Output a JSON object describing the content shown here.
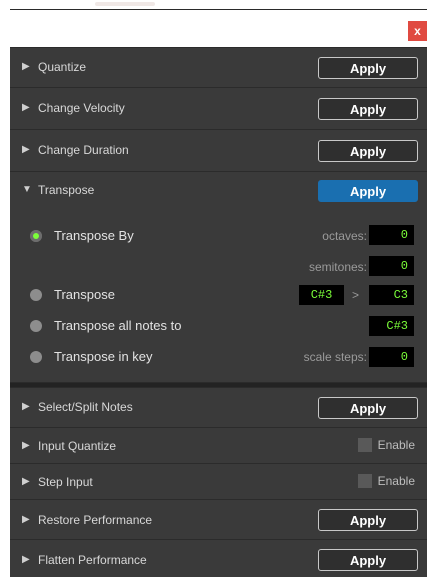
{
  "window": {
    "close_label": "x"
  },
  "sections": {
    "quantize": {
      "title": "Quantize",
      "arrow": "▶",
      "apply": "Apply"
    },
    "change_velocity": {
      "title": "Change Velocity",
      "arrow": "▶",
      "apply": "Apply"
    },
    "change_duration": {
      "title": "Change Duration",
      "arrow": "▶",
      "apply": "Apply"
    },
    "transpose": {
      "title": "Transpose",
      "arrow": "▼",
      "apply": "Apply",
      "options": {
        "transpose_by": {
          "label": "Transpose By",
          "selected": true
        },
        "transpose": {
          "label": "Transpose",
          "selected": false
        },
        "transpose_all": {
          "label": "Transpose all notes to",
          "selected": false
        },
        "transpose_in_key": {
          "label": "Transpose in key",
          "selected": false
        }
      },
      "fields": {
        "octaves_label": "octaves:",
        "octaves_value": "0",
        "semitones_label": "semitones:",
        "semitones_value": "0",
        "from_note": "C#3",
        "arrow_symbol": ">",
        "to_note": "C3",
        "all_notes_to": "C#3",
        "scale_steps_label": "scale steps:",
        "scale_steps_value": "0"
      }
    },
    "select_split": {
      "title": "Select/Split Notes",
      "arrow": "▶",
      "apply": "Apply"
    },
    "input_quantize": {
      "title": "Input Quantize",
      "arrow": "▶",
      "enable": "Enable"
    },
    "step_input": {
      "title": "Step Input",
      "arrow": "▶",
      "enable": "Enable"
    },
    "restore_performance": {
      "title": "Restore Performance",
      "arrow": "▶",
      "apply": "Apply"
    },
    "flatten_performance": {
      "title": "Flatten Performance",
      "arrow": "▶",
      "apply": "Apply"
    }
  },
  "colors": {
    "accent_apply": "#1a6fb0",
    "field_text": "#7cff3a",
    "close_bg": "#e04a41",
    "panel_bg": "#3a3a3a"
  }
}
